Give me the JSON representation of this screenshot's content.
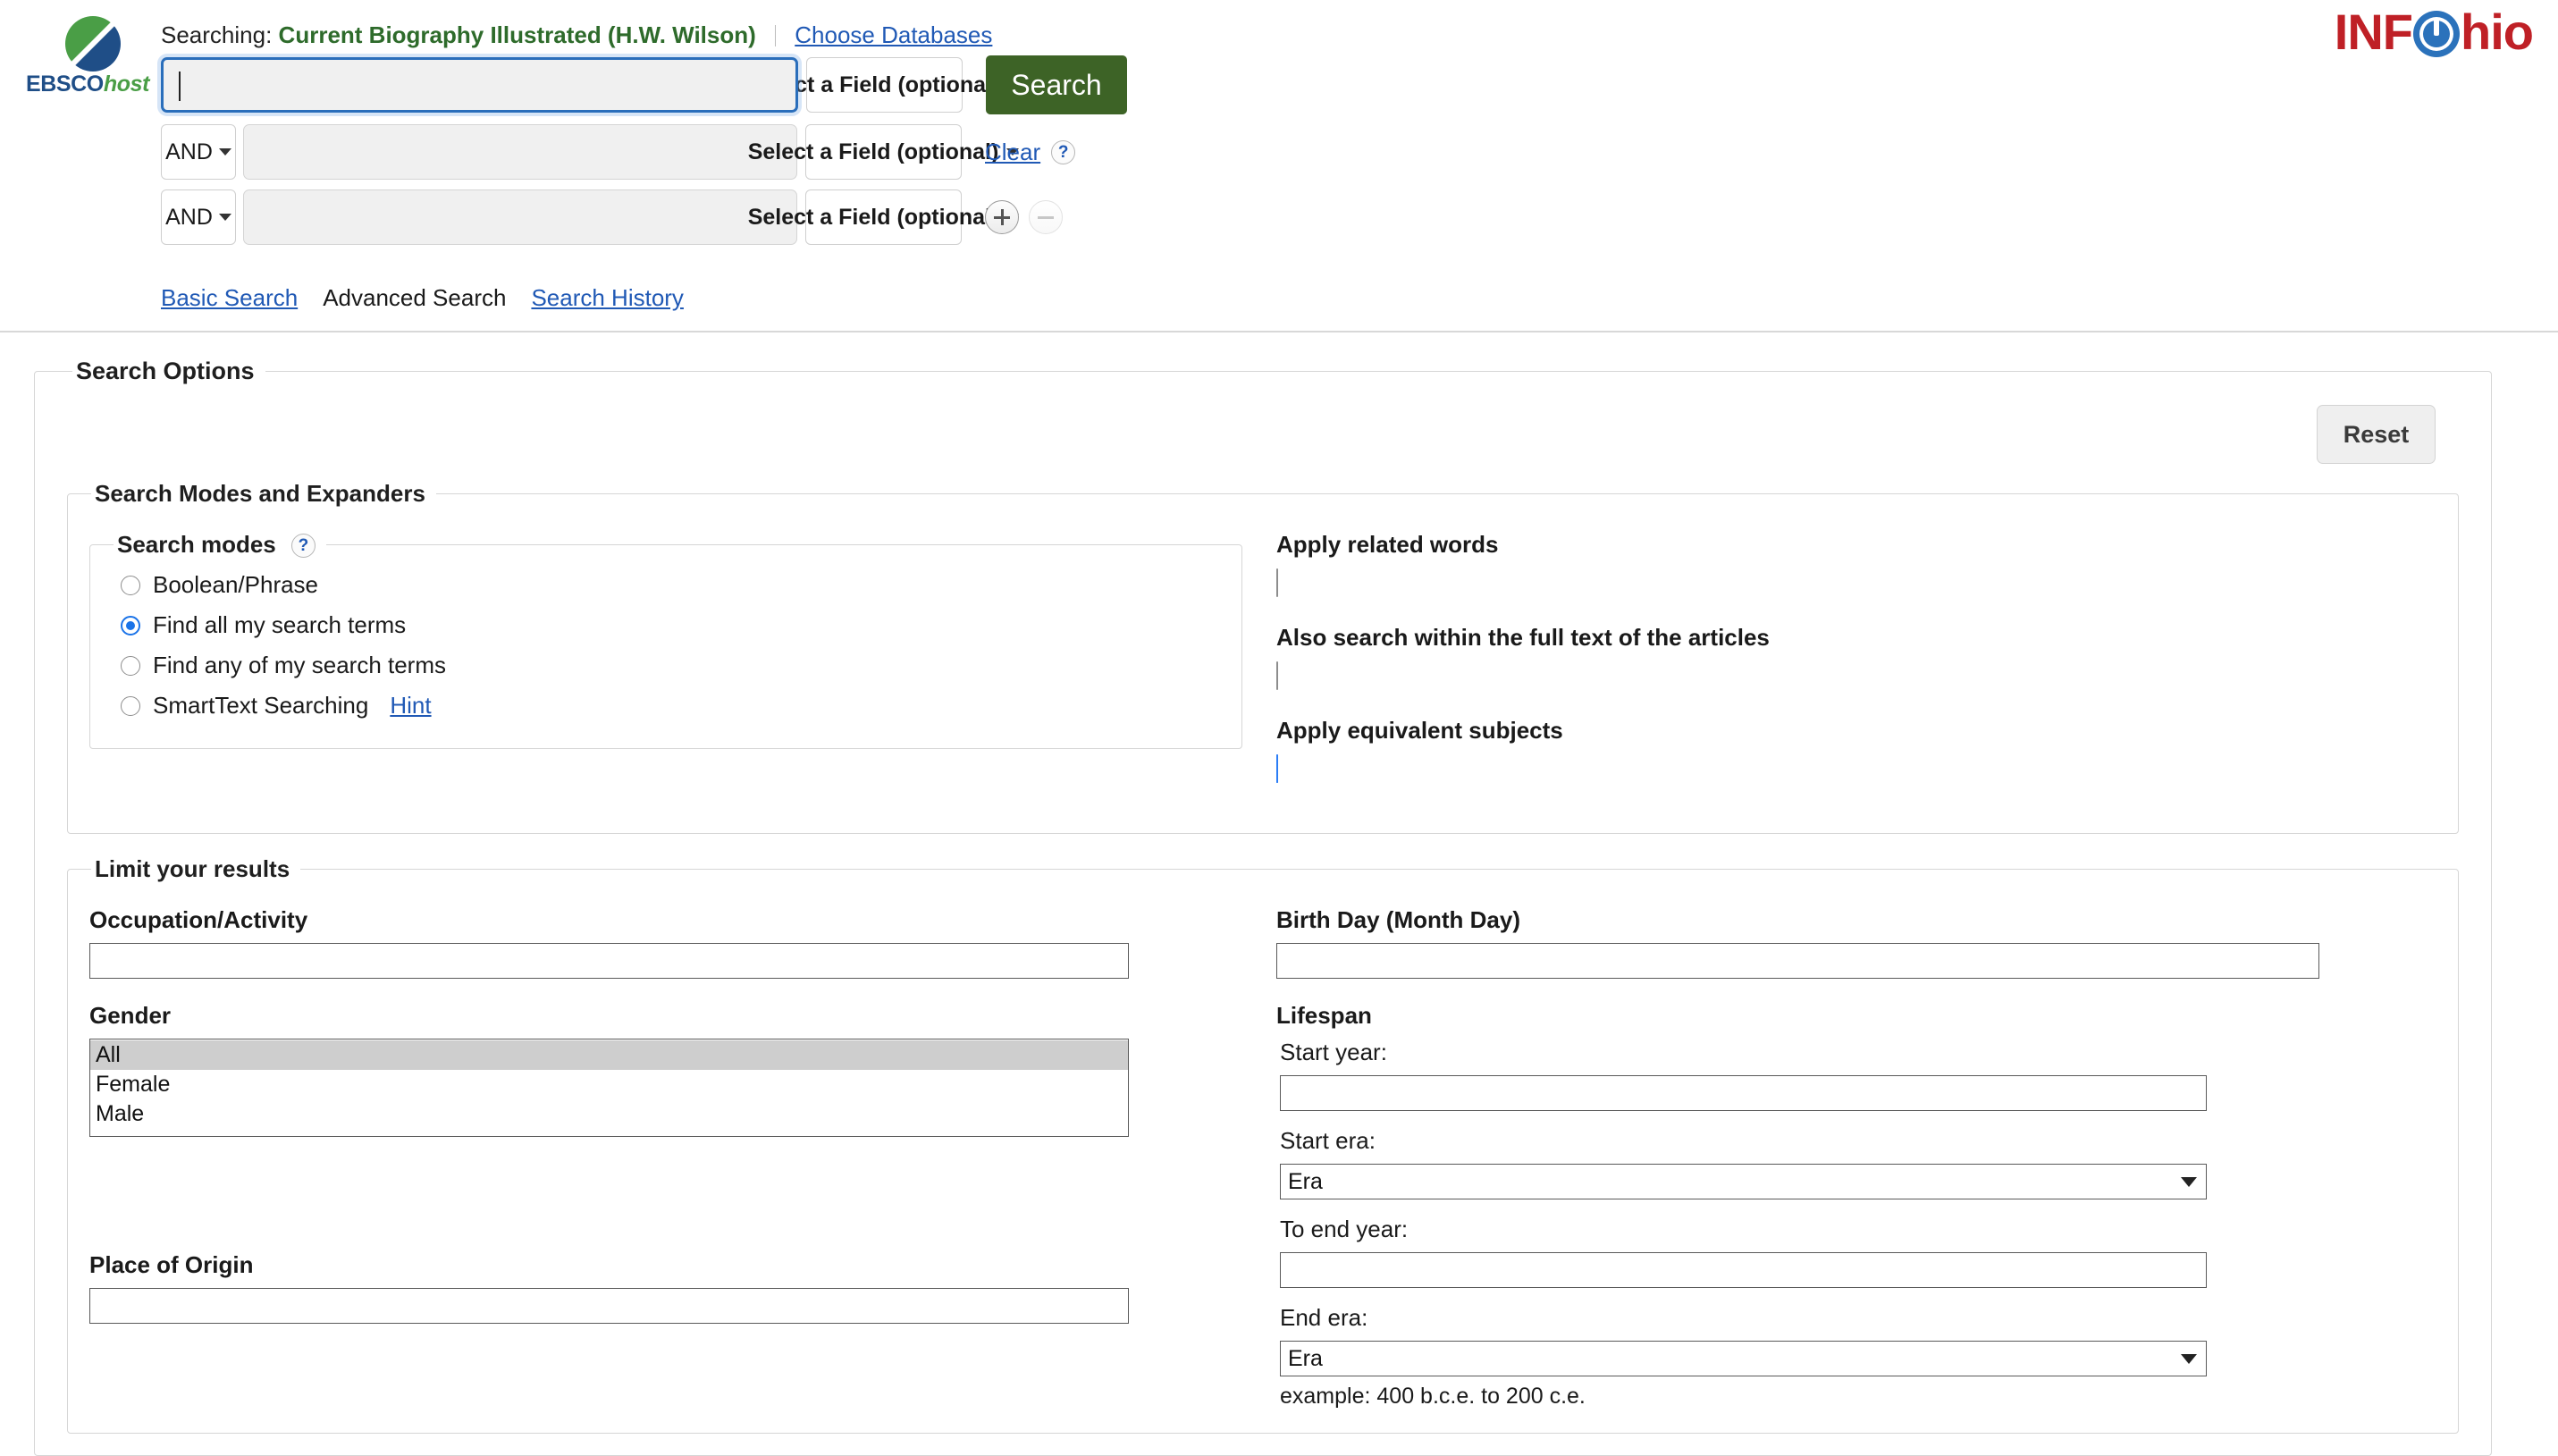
{
  "header": {
    "logo_text_primary": "EBSCO",
    "logo_text_secondary": "host",
    "searching_label": "Searching:",
    "database_name": "Current Biography Illustrated (H.W. Wilson)",
    "choose_databases_link": "Choose Databases",
    "brand_logo": "INFOhio",
    "brand_logo_prefix": "INF",
    "brand_logo_suffix": "hio",
    "accent_green": "#2e6b2b",
    "link_blue": "#2059b5",
    "search_button_green": "#3d6326",
    "brand_red": "#bf2026",
    "brand_blue": "#2b72bb"
  },
  "search_form": {
    "rows": [
      {
        "boolean": "",
        "value": "",
        "field": "Select a Field (optional)",
        "focused": true
      },
      {
        "boolean": "AND",
        "value": "",
        "field": "Select a Field (optional)",
        "focused": false
      },
      {
        "boolean": "AND",
        "value": "",
        "field": "Select a Field (optional)",
        "focused": false
      }
    ],
    "search_button": "Search",
    "clear_link": "Clear",
    "help_icon": "question-mark-icon",
    "add_row_icon": "plus-icon",
    "remove_row_icon": "minus-icon"
  },
  "mode_links": {
    "basic_search": "Basic Search",
    "advanced_search": "Advanced Search",
    "search_history": "Search History"
  },
  "search_options": {
    "legend": "Search Options",
    "reset_button": "Reset"
  },
  "search_modes_expanders": {
    "legend": "Search Modes and Expanders",
    "modes_legend": "Search modes",
    "modes_help_icon": "question-mark-icon",
    "modes": [
      {
        "label": "Boolean/Phrase",
        "selected": false
      },
      {
        "label": "Find all my search terms",
        "selected": true
      },
      {
        "label": "Find any of my search terms",
        "selected": false
      },
      {
        "label": "SmartText Searching",
        "selected": false,
        "hint": "Hint"
      }
    ],
    "expanders": [
      {
        "label": "Apply related words",
        "checked": false
      },
      {
        "label": "Also search within the full text of the articles",
        "checked": false
      },
      {
        "label": "Apply equivalent subjects",
        "checked": true
      }
    ]
  },
  "limit_results": {
    "legend": "Limit your results",
    "occupation": {
      "label": "Occupation/Activity",
      "value": ""
    },
    "gender": {
      "label": "Gender",
      "options": [
        "All",
        "Female",
        "Male"
      ],
      "selected": "All"
    },
    "place_of_origin": {
      "label": "Place of Origin",
      "value": ""
    },
    "birth_day": {
      "label": "Birth Day (Month Day)",
      "value": ""
    },
    "lifespan": {
      "label": "Lifespan",
      "start_year": {
        "label": "Start year:",
        "value": ""
      },
      "start_era": {
        "label": "Start era:",
        "value": "Era"
      },
      "end_year": {
        "label": "To end year:",
        "value": ""
      },
      "end_era": {
        "label": "End era:",
        "value": "Era"
      },
      "example": "example: 400 b.c.e. to 200 c.e."
    }
  }
}
